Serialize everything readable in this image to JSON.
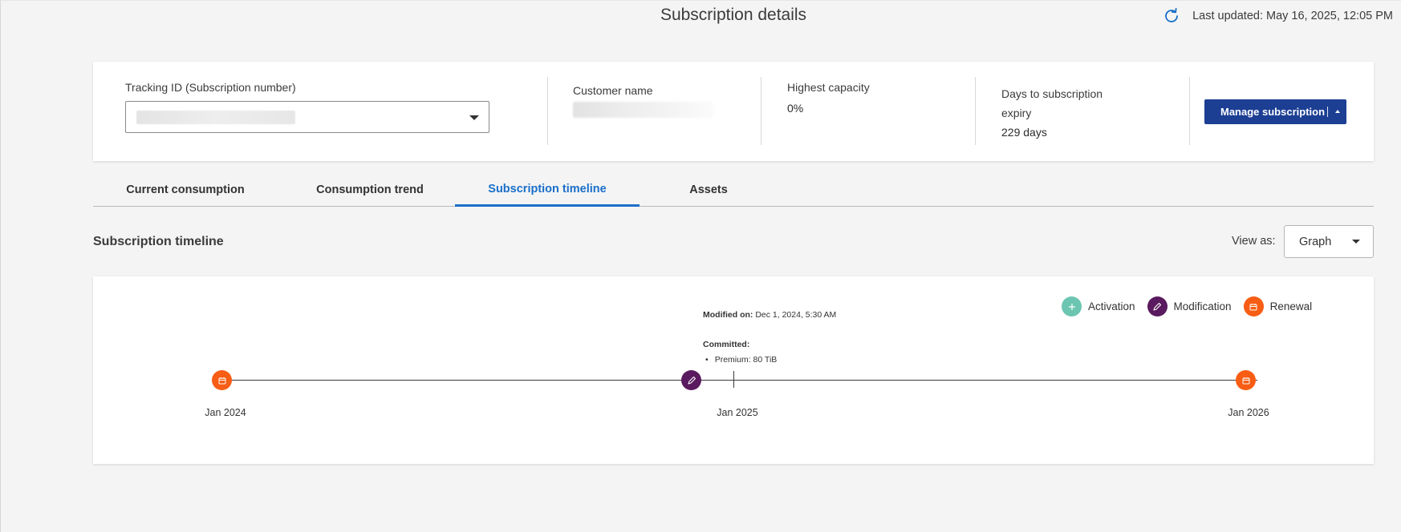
{
  "header": {
    "title": "Subscription details",
    "last_updated": "Last updated: May 16, 2025, 12:05 PM",
    "refresh_icon": "refresh-icon"
  },
  "summary": {
    "tracking_label": "Tracking ID (Subscription number)",
    "customer_label": "Customer name",
    "capacity_label": "Highest capacity",
    "capacity_value": "0%",
    "expiry_label_line1": "Days to subscription",
    "expiry_label_line2": "expiry",
    "expiry_value": "229 days",
    "manage_button": "Manage subscription"
  },
  "tabs": [
    {
      "label": "Current consumption"
    },
    {
      "label": "Consumption trend"
    },
    {
      "label": "Subscription timeline",
      "active": true
    },
    {
      "label": "Assets"
    }
  ],
  "section": {
    "title": "Subscription timeline",
    "view_as_label": "View as:",
    "view_as_value": "Graph"
  },
  "legend": {
    "activation": "Activation",
    "modification": "Modification",
    "renewal": "Renewal"
  },
  "timeline": {
    "tooltip_modified_label": "Modified on:",
    "tooltip_modified_value": "Dec 1, 2024, 5:30 AM",
    "tooltip_committed_label": "Committed:",
    "tooltip_item": "Premium: 80 TiB",
    "axis": [
      "Jan 2024",
      "Jan 2025",
      "Jan 2026"
    ],
    "events": [
      {
        "type": "Renewal"
      },
      {
        "type": "Modification"
      },
      {
        "type": "Renewal"
      }
    ]
  },
  "colors": {
    "activation": "#6cc5b0",
    "modification": "#5a1a5f",
    "renewal": "#f75d14",
    "accent": "#1a6fc9",
    "button": "#1c3f94"
  }
}
